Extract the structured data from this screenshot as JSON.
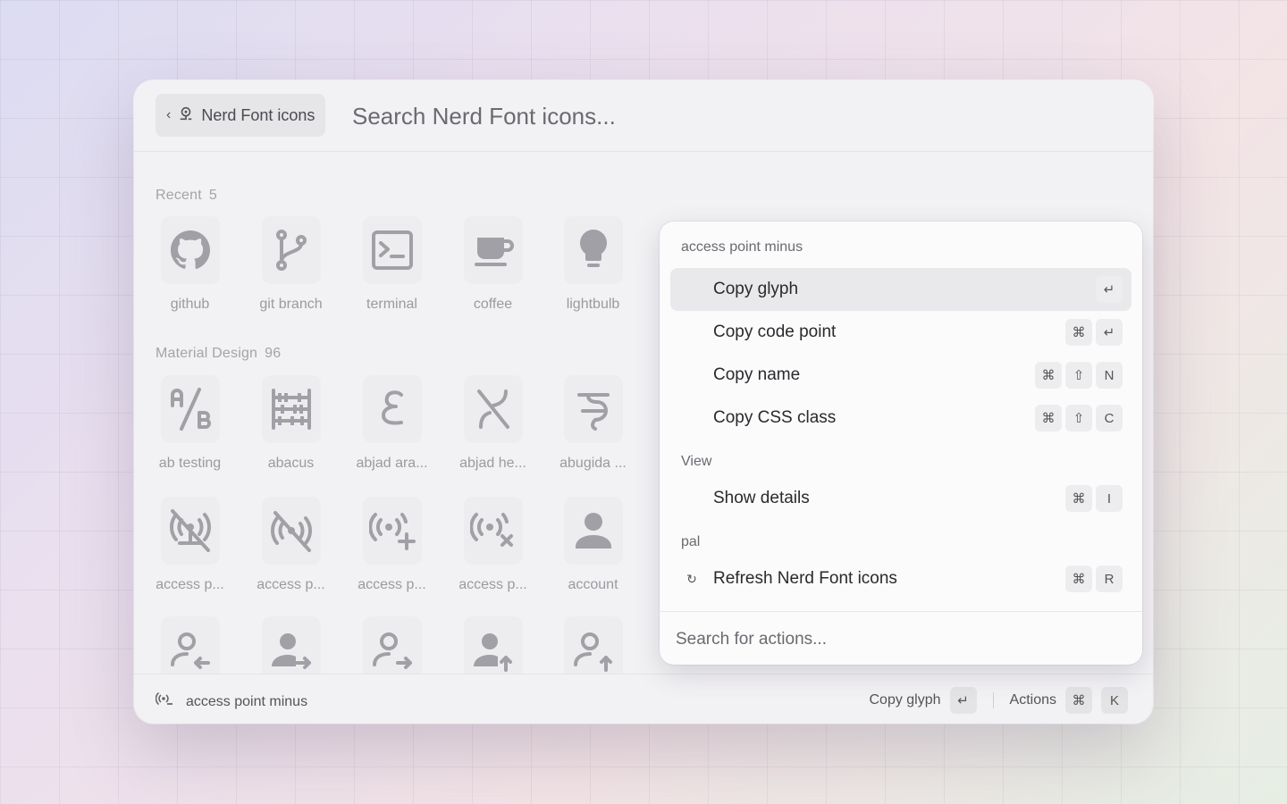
{
  "header": {
    "crumb_label": "Nerd Font icons",
    "search_placeholder": "Search Nerd Font icons..."
  },
  "sections": {
    "recent": {
      "title": "Recent",
      "count": "5"
    },
    "material": {
      "title": "Material Design",
      "count": "96"
    }
  },
  "recent_icons": [
    {
      "label": "github",
      "icon": "github-icon"
    },
    {
      "label": "git branch",
      "icon": "git-branch-icon"
    },
    {
      "label": "terminal",
      "icon": "terminal-icon"
    },
    {
      "label": "coffee",
      "icon": "coffee-icon"
    },
    {
      "label": "lightbulb",
      "icon": "lightbulb-icon"
    }
  ],
  "material_icons": [
    {
      "label": "ab testing",
      "icon": "ab-testing-icon"
    },
    {
      "label": "abacus",
      "icon": "abacus-icon"
    },
    {
      "label": "abjad ara...",
      "icon": "abjad-arabic-icon"
    },
    {
      "label": "abjad he...",
      "icon": "abjad-hebrew-icon"
    },
    {
      "label": "abugida ...",
      "icon": "abugida-icon"
    },
    {
      "label": "access p...",
      "icon": "access-point-network-off-icon"
    },
    {
      "label": "access p...",
      "icon": "access-point-off-icon"
    },
    {
      "label": "access p...",
      "icon": "access-point-plus-icon"
    },
    {
      "label": "access p...",
      "icon": "access-point-remove-icon"
    },
    {
      "label": "account",
      "icon": "account-icon"
    }
  ],
  "action_panel": {
    "group_selected": "access point minus",
    "group_view": "View",
    "group_pal": "pal",
    "actions": [
      {
        "label": "Copy glyph",
        "keys": [
          "↵"
        ]
      },
      {
        "label": "Copy code point",
        "keys": [
          "⌘",
          "↵"
        ]
      },
      {
        "label": "Copy name",
        "keys": [
          "⌘",
          "⇧",
          "N"
        ]
      },
      {
        "label": "Copy CSS class",
        "keys": [
          "⌘",
          "⇧",
          "C"
        ]
      },
      {
        "label": "Show details",
        "keys": [
          "⌘",
          "I"
        ]
      },
      {
        "label": "Refresh Nerd Font icons",
        "keys": [
          "⌘",
          "R"
        ],
        "icon": "↻"
      }
    ],
    "search_placeholder": "Search for actions..."
  },
  "footer": {
    "selected_label": "access point minus",
    "primary_action": "Copy glyph",
    "primary_key": "↵",
    "actions_label": "Actions",
    "actions_keys": [
      "⌘",
      "K"
    ]
  }
}
